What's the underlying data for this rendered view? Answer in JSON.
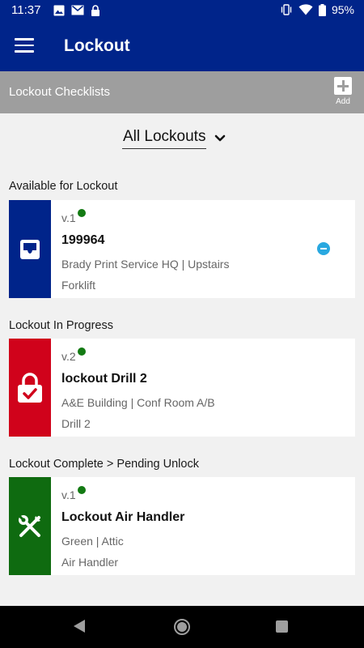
{
  "status_bar": {
    "time": "11:37",
    "battery": "95%",
    "left_icons": [
      "image-icon",
      "gmail-icon",
      "lock-icon"
    ],
    "right_icons": [
      "vibrate-icon",
      "wifi-icon",
      "battery-icon"
    ]
  },
  "app_bar": {
    "title": "Lockout",
    "menu_icon": "menu-icon"
  },
  "sub_bar": {
    "title": "Lockout Checklists",
    "add_label": "Add"
  },
  "filter": {
    "selected": "All Lockouts"
  },
  "sections": [
    {
      "header": "Available for Lockout",
      "card": {
        "version": "v.1",
        "title": "199964",
        "location": "Brady Print Service HQ | Upstairs",
        "equipment": "Forklift",
        "icon": "tray-icon",
        "color": "#00248a"
      }
    },
    {
      "header": "Lockout In Progress",
      "card": {
        "version": "v.2",
        "title": "lockout Drill 2",
        "location": "A&E Building | Conf Room A/B",
        "equipment": "Drill 2",
        "icon": "padlock-check-icon",
        "color": "#d0021b"
      }
    },
    {
      "header": "Lockout Complete > Pending Unlock",
      "card": {
        "version": "v.1",
        "title": "Lockout Air Handler",
        "location": "Green | Attic",
        "equipment": "Air Handler",
        "icon": "tools-icon",
        "color": "#0f6b10"
      }
    }
  ],
  "colors": {
    "primary": "#00248a",
    "sub_bar": "#9e9e9e",
    "status_green": "#137a13",
    "remove_blue": "#29a8e0"
  }
}
